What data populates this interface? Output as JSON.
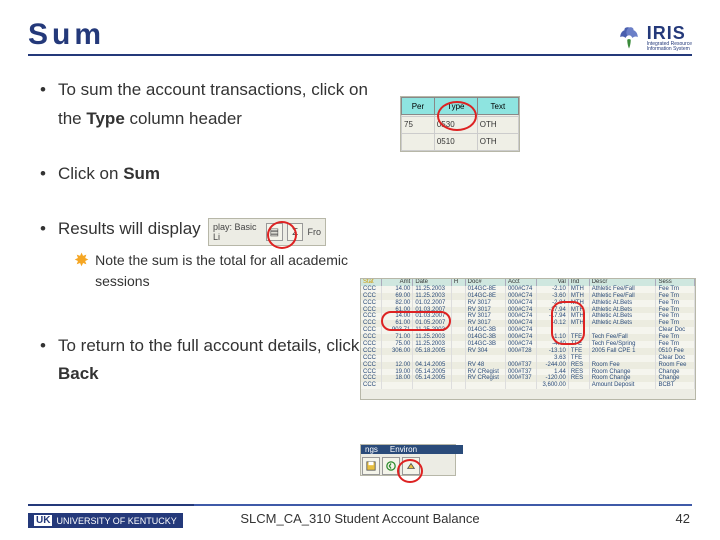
{
  "title": "Sum",
  "logo": {
    "name": "IRIS",
    "sub1": "Integrated Resource",
    "sub2": "Information System"
  },
  "bullets": {
    "b1a": "To sum the account transactions, click on the ",
    "b1b": "Type",
    "b1c": " column header",
    "b2a": "Click on ",
    "b2b": "Sum",
    "b3": "Results will display",
    "note": "Note the sum is the total for all academic sessions",
    "b4a": "To return to the full account details, click ",
    "b4b": "Back"
  },
  "shot1": {
    "headers": [
      "Per",
      "Type",
      "Text"
    ],
    "rows": [
      [
        "",
        "",
        ""
      ],
      [
        "75",
        "0530",
        "OTH"
      ],
      [
        "",
        "0510",
        "OTH"
      ]
    ]
  },
  "shot2": {
    "label_left": "play: Basic Li",
    "sigma": "Σ",
    "label_right": "Fro"
  },
  "shot3": {
    "headers": [
      "Stat",
      "Amt",
      "Date",
      "H",
      "Doc#",
      "Acct",
      "Val",
      "Ind",
      "Descr",
      "Sess"
    ],
    "rows": [
      [
        "CCC",
        "14.00",
        "11.25.2003",
        "",
        "014GC-8E",
        "000#C74",
        "-2.10",
        "MTH",
        "Athletic Fee/Fall",
        "Fee Trn"
      ],
      [
        "CCC",
        "69.00",
        "11.25.2003",
        "",
        "014GC-8E",
        "000#C74",
        "-3.60",
        "MTH",
        "Athletic Fee/Fall",
        "Fee Trn"
      ],
      [
        "CCC",
        "82.00",
        "01.02.2007",
        "",
        "RV 3017",
        "000#C74",
        "-2.84",
        "MTH",
        "Athletic At.Bets",
        "Fee Trn"
      ],
      [
        "CCC",
        "61.00",
        "01.03.2007",
        "",
        "RV 3017",
        "000#C74",
        "-17.94",
        "MTH",
        "Athletic At.Bets",
        "Fee Trn"
      ],
      [
        "CCC",
        "14.00",
        "01.03.2007",
        "",
        "RV 3017",
        "000#C74",
        "-17.94",
        "MTH",
        "Athletic At.Bets",
        "Fee Trn"
      ],
      [
        "CCC",
        "61.00",
        "01.05.2007",
        "",
        "RV 3017",
        "000#C74",
        "-0.12",
        "MTH",
        "Athletic At.Bets",
        "Fee Trn"
      ],
      [
        "CCC",
        "903.71",
        "11.25.2003",
        "",
        "014GC-3B",
        "000#C74",
        "",
        "",
        "",
        "Clear Doc"
      ],
      [
        "CCC",
        "71.00",
        "11.25.2003",
        "",
        "014GC-3B",
        "000#C74",
        "-1.10",
        "TFE",
        "Tech Fee/Fall",
        "Fee Trn"
      ],
      [
        "CCC",
        "75.00",
        "11.25.2003",
        "",
        "014GC-3B",
        "000#C74",
        "-4.40",
        "TFE",
        "Tech Fee/Spring",
        "Fee Trn"
      ],
      [
        "CCC",
        "306.00",
        "05.18.2005",
        "",
        "RV 304",
        "000#T28",
        "-13.10",
        "TFE",
        "2005 Fall CPE 1",
        "0510 Fee"
      ],
      [
        "CCC",
        "",
        "",
        "",
        "",
        "",
        "3.63",
        "TFE",
        "",
        "Clear Doc"
      ],
      [
        "CCC",
        "12.00",
        "04.14.2005",
        "",
        "RV 48",
        "000#T37",
        "-244.00",
        "RES",
        "Room Fee",
        "Room Fee"
      ],
      [
        "CCC",
        "19.00",
        "05.14.2005",
        "",
        "RV CRegist",
        "000#T37",
        "1.44",
        "RES",
        "Room Change",
        "Change"
      ],
      [
        "CCC",
        "18.00",
        "05.14.2005",
        "",
        "RV CRegist",
        "000#T37",
        "-120.00",
        "RES",
        "Room Change",
        "Change"
      ],
      [
        "CCC",
        "",
        "",
        "",
        "",
        "",
        "3,600.00",
        "",
        "Amount Deposit",
        "BCBT"
      ]
    ]
  },
  "shot4": {
    "tab1": "ngs",
    "tab2": "Environ"
  },
  "footer": {
    "uni": "UNIVERSITY OF KENTUCKY",
    "center": "SLCM_CA_310 Student Account Balance",
    "page": "42"
  }
}
